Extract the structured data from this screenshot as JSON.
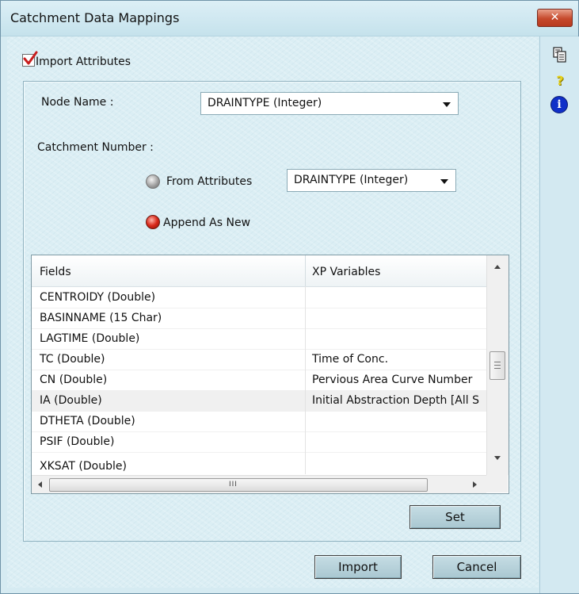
{
  "window": {
    "title": "Catchment Data Mappings",
    "close_glyph": "✕"
  },
  "import_attributes": {
    "label": "Import Attributes",
    "checked": true
  },
  "node_name": {
    "label": "Node Name :",
    "value": "DRAINTYPE (Integer)"
  },
  "catchment_number": {
    "label": "Catchment Number :",
    "from_attributes": {
      "label": "From Attributes",
      "selected": false,
      "value": "DRAINTYPE (Integer)"
    },
    "append_as_new": {
      "label": "Append As New",
      "selected": true
    }
  },
  "grid": {
    "columns": [
      "Fields",
      "XP Variables"
    ],
    "rows": [
      {
        "field": "CENTROIDY (Double)",
        "variable": ""
      },
      {
        "field": "BASINNAME (15 Char)",
        "variable": ""
      },
      {
        "field": "LAGTIME (Double)",
        "variable": ""
      },
      {
        "field": "TC (Double)",
        "variable": "Time of Conc."
      },
      {
        "field": "CN (Double)",
        "variable": "Pervious Area Curve Number"
      },
      {
        "field": "IA (Double)",
        "variable": "Initial Abstraction Depth [All S"
      },
      {
        "field": "DTHETA (Double)",
        "variable": ""
      },
      {
        "field": "PSIF (Double)",
        "variable": ""
      },
      {
        "field": "XKSAT (Double)",
        "variable": ""
      }
    ],
    "selected_row_index": 5,
    "hscroll_grip": "III"
  },
  "buttons": {
    "set": "Set",
    "import": "Import",
    "cancel": "Cancel"
  },
  "side_tools": [
    {
      "icon": "copy-icon"
    },
    {
      "icon": "help-icon",
      "glyph": "?"
    },
    {
      "icon": "info-icon",
      "glyph": "i"
    }
  ],
  "colors": {
    "selected_radio": "#d8281a",
    "help": "#e8d21a",
    "info": "#1030c8"
  }
}
